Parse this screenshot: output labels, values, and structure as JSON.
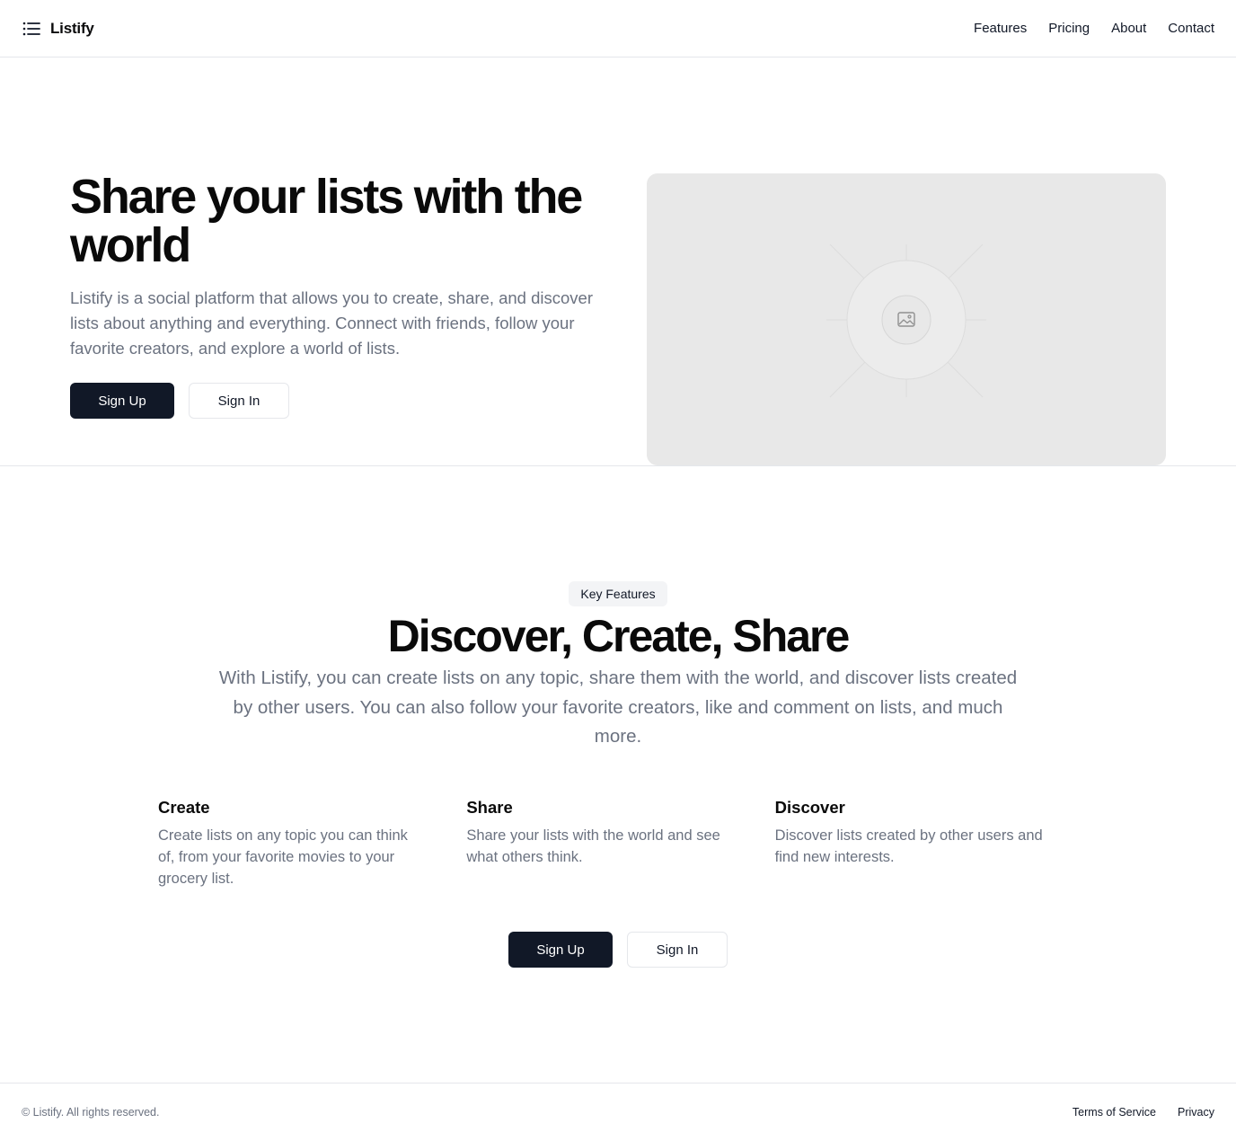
{
  "header": {
    "brand": "Listify",
    "nav": [
      "Features",
      "Pricing",
      "About",
      "Contact"
    ]
  },
  "hero": {
    "title": "Share your lists with the world",
    "description": "Listify is a social platform that allows you to create, share, and discover lists about anything and everything. Connect with friends, follow your favorite creators, and explore a world of lists.",
    "primary_cta": "Sign Up",
    "secondary_cta": "Sign In",
    "image_icon": "image-placeholder-icon"
  },
  "features": {
    "badge": "Key Features",
    "title": "Discover, Create, Share",
    "description": "With Listify, you can create lists on any topic, share them with the world, and discover lists created by other users. You can also follow your favorite creators, like and comment on lists, and much more.",
    "items": [
      {
        "title": "Create",
        "text": "Create lists on any topic you can think of, from your favorite movies to your grocery list."
      },
      {
        "title": "Share",
        "text": "Share your lists with the world and see what others think."
      },
      {
        "title": "Discover",
        "text": "Discover lists created by other users and find new interests."
      }
    ],
    "primary_cta": "Sign Up",
    "secondary_cta": "Sign In"
  },
  "footer": {
    "copyright": "© Listify. All rights reserved.",
    "links": [
      "Terms of Service",
      "Privacy"
    ]
  },
  "colors": {
    "primary": "#111827",
    "muted_text": "#6b7280",
    "border": "#e5e7eb",
    "placeholder_bg": "#e8e8e8"
  }
}
